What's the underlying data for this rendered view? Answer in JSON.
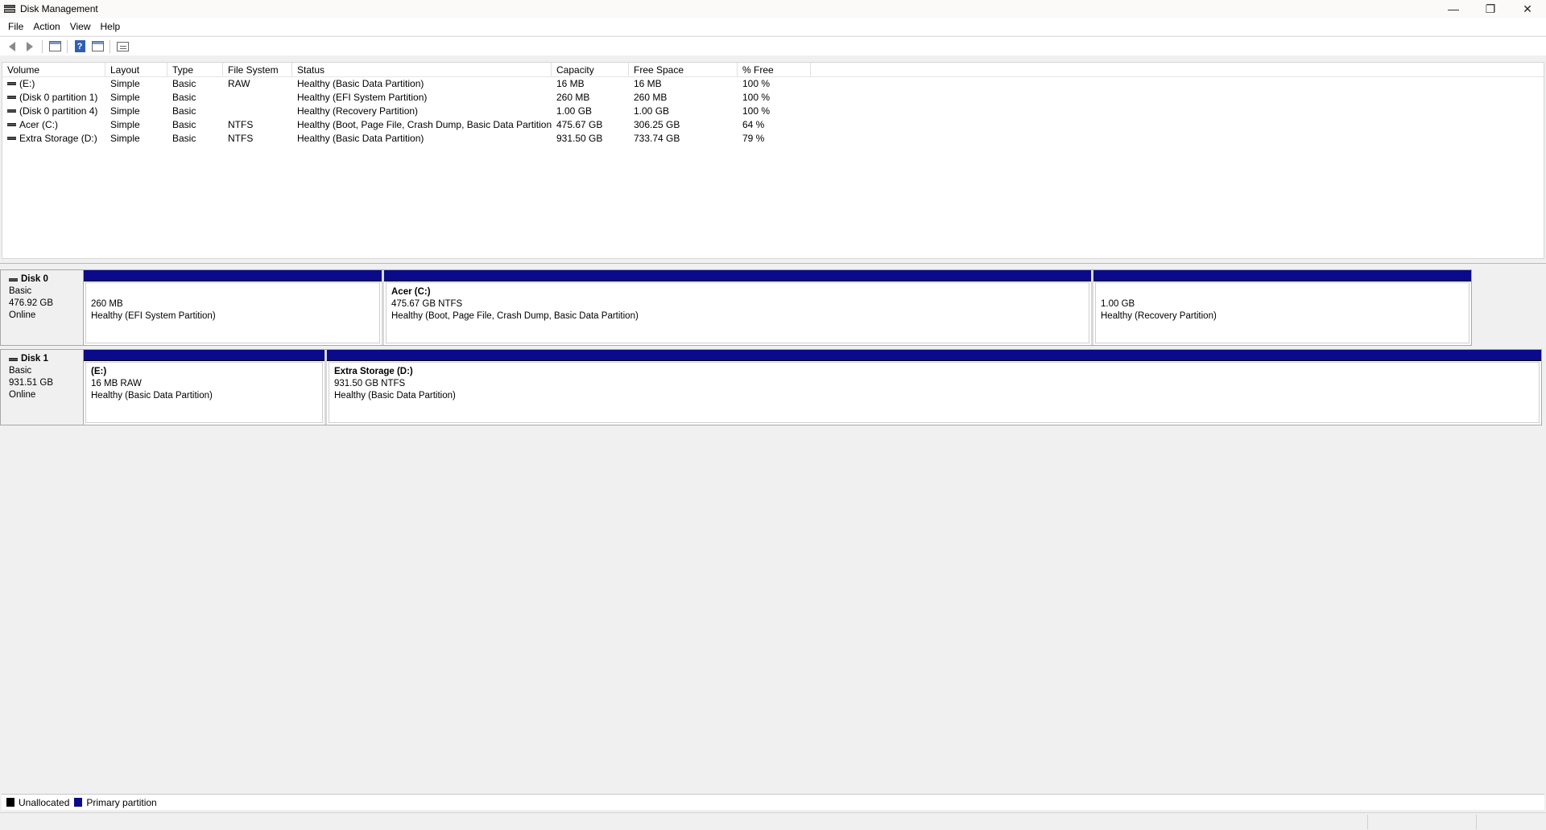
{
  "window": {
    "title": "Disk Management",
    "controls": {
      "minimize": "—",
      "maximize": "❐",
      "close": "✕"
    }
  },
  "menu": [
    "File",
    "Action",
    "View",
    "Help"
  ],
  "toolbar": {
    "icons": [
      "back-arrow-icon",
      "forward-arrow-icon",
      "console-tree-icon",
      "help-icon",
      "show-hide-action-pane-icon",
      "properties-icon"
    ]
  },
  "volume_list": {
    "columns": [
      "Volume",
      "Layout",
      "Type",
      "File System",
      "Status",
      "Capacity",
      "Free Space",
      "% Free",
      ""
    ],
    "rows": [
      {
        "volume": "(E:)",
        "layout": "Simple",
        "type": "Basic",
        "fs": "RAW",
        "status": "Healthy (Basic Data Partition)",
        "capacity": "16 MB",
        "free": "16 MB",
        "pct": "100 %"
      },
      {
        "volume": "(Disk 0 partition 1)",
        "layout": "Simple",
        "type": "Basic",
        "fs": "",
        "status": "Healthy (EFI System Partition)",
        "capacity": "260 MB",
        "free": "260 MB",
        "pct": "100 %"
      },
      {
        "volume": "(Disk 0 partition 4)",
        "layout": "Simple",
        "type": "Basic",
        "fs": "",
        "status": "Healthy (Recovery Partition)",
        "capacity": "1.00 GB",
        "free": "1.00 GB",
        "pct": "100 %"
      },
      {
        "volume": "Acer (C:)",
        "layout": "Simple",
        "type": "Basic",
        "fs": "NTFS",
        "status": "Healthy (Boot, Page File, Crash Dump, Basic Data Partition)",
        "capacity": "475.67 GB",
        "free": "306.25 GB",
        "pct": "64 %"
      },
      {
        "volume": "Extra Storage (D:)",
        "layout": "Simple",
        "type": "Basic",
        "fs": "NTFS",
        "status": "Healthy (Basic Data Partition)",
        "capacity": "931.50 GB",
        "free": "733.74 GB",
        "pct": "79 %"
      }
    ]
  },
  "disks": [
    {
      "name": "Disk 0",
      "kind": "Basic",
      "size": "476.92 GB",
      "state": "Online",
      "partitions": [
        {
          "title": "",
          "line1": "260 MB",
          "line2": "Healthy (EFI System Partition)"
        },
        {
          "title": "Acer  (C:)",
          "line1": "475.67 GB NTFS",
          "line2": "Healthy (Boot, Page File, Crash Dump, Basic Data Partition)"
        },
        {
          "title": "",
          "line1": "1.00 GB",
          "line2": "Healthy (Recovery Partition)"
        }
      ]
    },
    {
      "name": "Disk 1",
      "kind": "Basic",
      "size": "931.51 GB",
      "state": "Online",
      "partitions": [
        {
          "title": "(E:)",
          "line1": "16 MB RAW",
          "line2": "Healthy (Basic Data Partition)"
        },
        {
          "title": "Extra Storage  (D:)",
          "line1": "931.50 GB NTFS",
          "line2": "Healthy (Basic Data Partition)"
        }
      ]
    }
  ],
  "legend": [
    {
      "label": "Unallocated",
      "color": "#000000"
    },
    {
      "label": "Primary partition",
      "color": "#0a0a8a"
    }
  ]
}
